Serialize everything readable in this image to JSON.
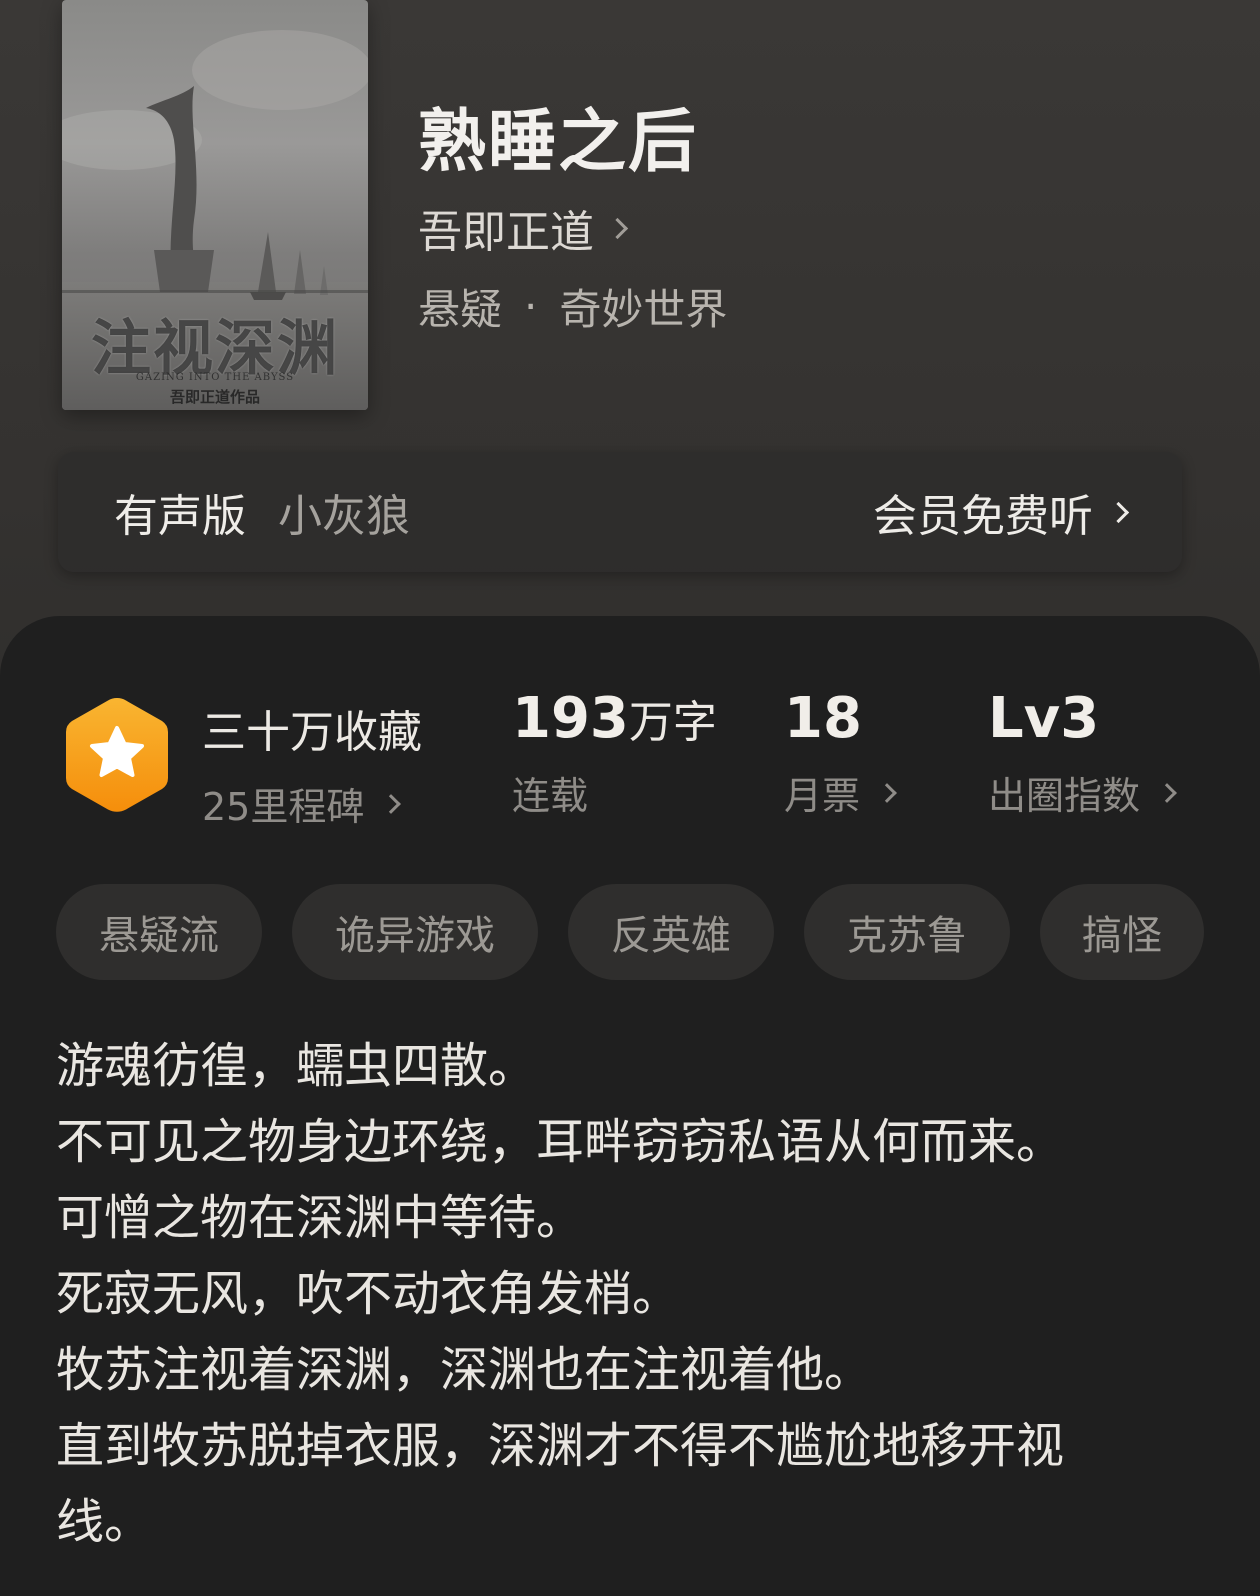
{
  "book": {
    "cover": {
      "title": "注视深渊",
      "subtitle": "GAZING INTO THE ABYSS",
      "author_line": "吾即正道作品"
    },
    "title": "熟睡之后",
    "author": "吾即正道",
    "genre": {
      "primary": "悬疑",
      "separator": "·",
      "secondary": "奇妙世界"
    }
  },
  "audio": {
    "label": "有声版",
    "narrator": "小灰狼",
    "cta": "会员免费听"
  },
  "stats": {
    "collection": {
      "primary": "三十万收藏",
      "secondary": "25里程碑",
      "badge_color": "#f6a31c",
      "badge_icon": "star-icon"
    },
    "words": {
      "number": "193",
      "unit": "万字",
      "label": "连载"
    },
    "monthly_tickets": {
      "number": "18",
      "label": "月票"
    },
    "level": {
      "value": "Lv3",
      "label": "出圈指数"
    }
  },
  "tags": [
    "悬疑流",
    "诡异游戏",
    "反英雄",
    "克苏鲁",
    "搞怪"
  ],
  "synopsis": [
    "游魂彷徨，蠕虫四散。",
    "不可见之物身边环绕，耳畔窃窃私语从何而来。",
    "可憎之物在深渊中等待。",
    "死寂无风，吹不动衣角发梢。",
    "牧苏注视着深渊，深渊也在注视着他。",
    "直到牧苏脱掉衣服，深渊才不得不尴尬地移开视",
    "线。"
  ]
}
